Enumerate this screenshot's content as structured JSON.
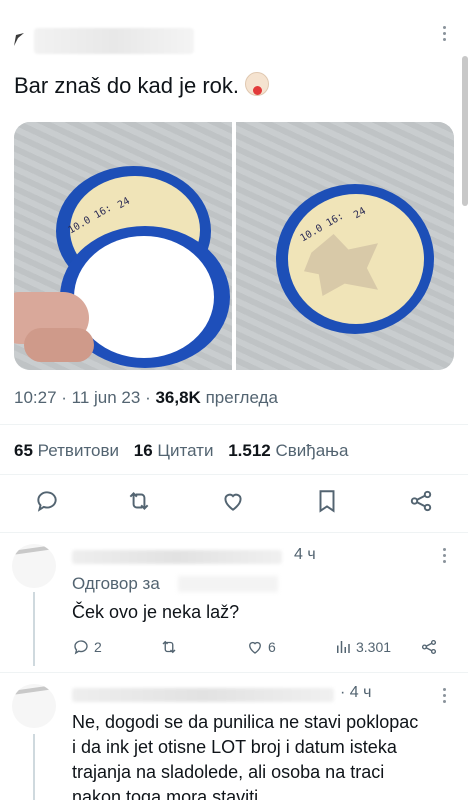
{
  "tweet": {
    "text": "Bar znaš do kad je rok.",
    "emoji_icon": "clown-face-icon",
    "image_text_left": "10.0 16:",
    "image_text_right": "10.0 16:",
    "ink_left_suffix": "24",
    "ink_right_suffix": "24",
    "time": "10:27",
    "date": "11 jun 23",
    "views_count": "36,8K",
    "views_label": "прегледа"
  },
  "stats": {
    "retweets_count": "65",
    "retweets_label": "Ретвитови",
    "quotes_count": "16",
    "quotes_label": "Цитати",
    "likes_count": "1.512",
    "likes_label": "Свиђања"
  },
  "actions": [
    "reply-icon",
    "retweet-icon",
    "like-icon",
    "bookmark-icon",
    "share-icon"
  ],
  "reply1": {
    "time": "4 ч",
    "replying_to": "Одговор за",
    "text": "Ček ovo je neka laž?",
    "replies": "2",
    "retweets": "",
    "likes": "6",
    "views": "3.301"
  },
  "reply2": {
    "time": "· 4 ч",
    "text": "Ne, dogodi se da punilica ne stavi poklopac i da ink jet otisne LOT broj i datum isteka trajanja na sladolede, ali osoba na traci nakon toga mora staviti"
  },
  "colors": {
    "text": "#0f1419",
    "secondary": "#536471",
    "divider": "#eff3f4",
    "lid_blue": "#1d4fb7"
  }
}
